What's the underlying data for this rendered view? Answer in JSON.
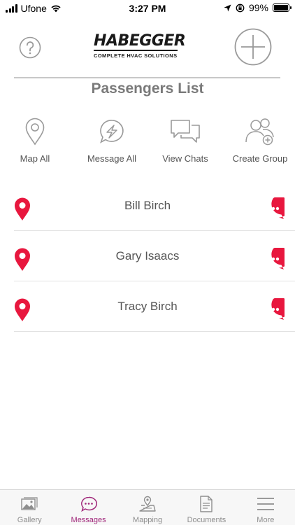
{
  "status_bar": {
    "carrier": "Ufone",
    "time": "3:27 PM",
    "battery": "99%",
    "battery_level": 0.99
  },
  "header": {
    "help_icon": "question-icon",
    "logo_text": "HABEGGER",
    "logo_tagline": "COMPLETE HVAC SOLUTIONS",
    "add_icon": "plus-circle-icon",
    "title": "Passengers List"
  },
  "actions": [
    {
      "label": "Map All",
      "icon": "map-pin-outline-icon"
    },
    {
      "label": "Message All",
      "icon": "lightning-chat-icon"
    },
    {
      "label": "View Chats",
      "icon": "chat-bubbles-icon"
    },
    {
      "label": "Create Group",
      "icon": "add-group-icon"
    }
  ],
  "passengers": [
    {
      "name": "Bill Birch"
    },
    {
      "name": "Gary Isaacs"
    },
    {
      "name": "Tracy Birch"
    }
  ],
  "tabs": [
    {
      "label": "Gallery",
      "icon": "gallery-icon",
      "active": false
    },
    {
      "label": "Messages",
      "icon": "message-icon",
      "active": true
    },
    {
      "label": "Mapping",
      "icon": "map-icon",
      "active": false
    },
    {
      "label": "Documents",
      "icon": "document-icon",
      "active": false
    },
    {
      "label": "More",
      "icon": "menu-icon",
      "active": false
    }
  ],
  "colors": {
    "accent_red": "#e8173e",
    "active_tab": "#a0277a",
    "icon_gray": "#9a9a9a"
  }
}
